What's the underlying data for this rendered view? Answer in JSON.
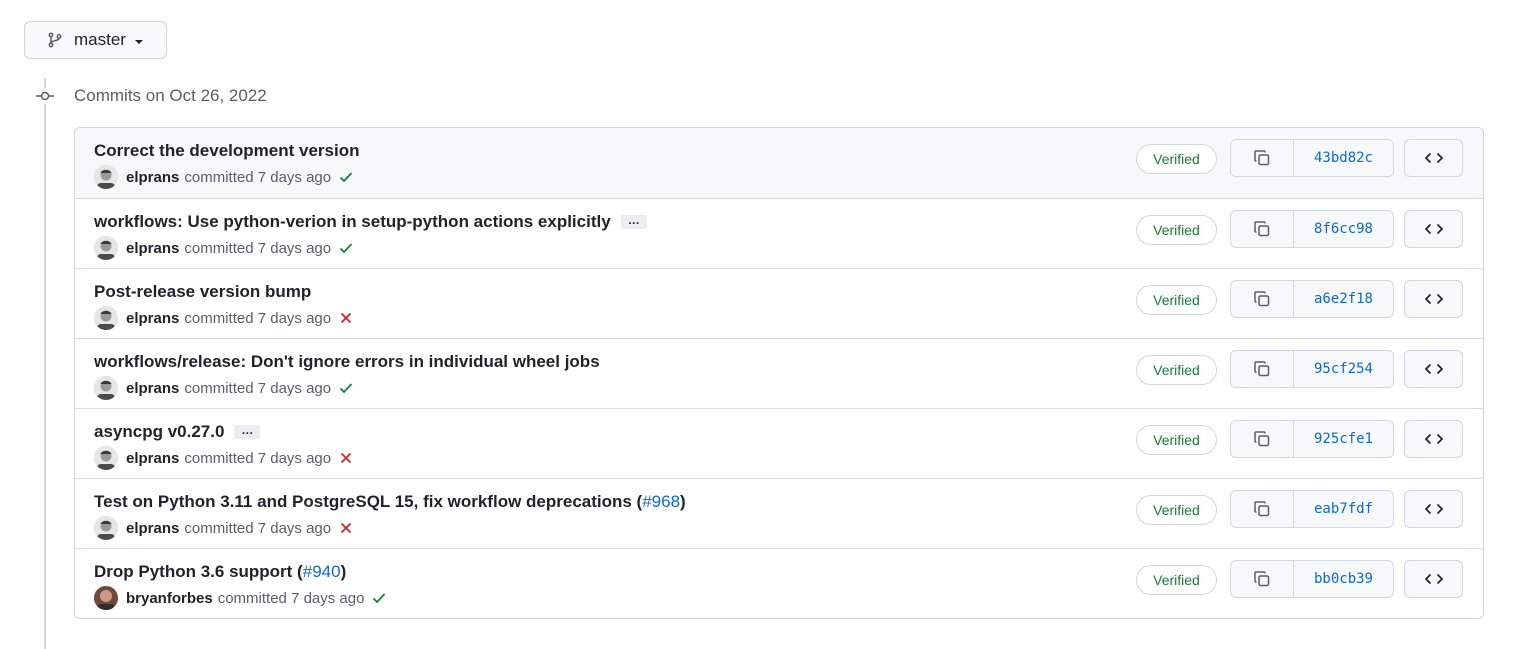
{
  "branch": {
    "name": "master",
    "icon": "git-branch-icon"
  },
  "group": {
    "title": "Commits on Oct 26, 2022"
  },
  "colors": {
    "success": "#1a7f37",
    "failure": "#cf222e",
    "link": "#0969da"
  },
  "commits": [
    {
      "title": "Correct the development version",
      "pr": "",
      "has_more": false,
      "author": "elprans",
      "when": "committed 7 days ago",
      "status": "success",
      "verified": "Verified",
      "sha": "43bd82c"
    },
    {
      "title": "workflows: Use python-verion in setup-python actions explicitly",
      "pr": "",
      "has_more": true,
      "author": "elprans",
      "when": "committed 7 days ago",
      "status": "success",
      "verified": "Verified",
      "sha": "8f6cc98"
    },
    {
      "title": "Post-release version bump",
      "pr": "",
      "has_more": false,
      "author": "elprans",
      "when": "committed 7 days ago",
      "status": "failure",
      "verified": "Verified",
      "sha": "a6e2f18"
    },
    {
      "title": "workflows/release: Don't ignore errors in individual wheel jobs",
      "pr": "",
      "has_more": false,
      "author": "elprans",
      "when": "committed 7 days ago",
      "status": "success",
      "verified": "Verified",
      "sha": "95cf254"
    },
    {
      "title": "asyncpg v0.27.0",
      "pr": "",
      "has_more": true,
      "author": "elprans",
      "when": "committed 7 days ago",
      "status": "failure",
      "verified": "Verified",
      "sha": "925cfe1"
    },
    {
      "title": "Test on Python 3.11 and PostgreSQL 15, fix workflow deprecations (",
      "pr": "#968",
      "has_more": false,
      "author": "elprans",
      "when": "committed 7 days ago",
      "status": "failure",
      "verified": "Verified",
      "sha": "eab7fdf"
    },
    {
      "title": "Drop Python 3.6 support (",
      "pr": "#940",
      "has_more": false,
      "author": "bryanforbes",
      "when": "committed 7 days ago",
      "status": "success",
      "verified": "Verified",
      "sha": "bb0cb39"
    }
  ],
  "ellipsis": "…",
  "close_paren": ")"
}
